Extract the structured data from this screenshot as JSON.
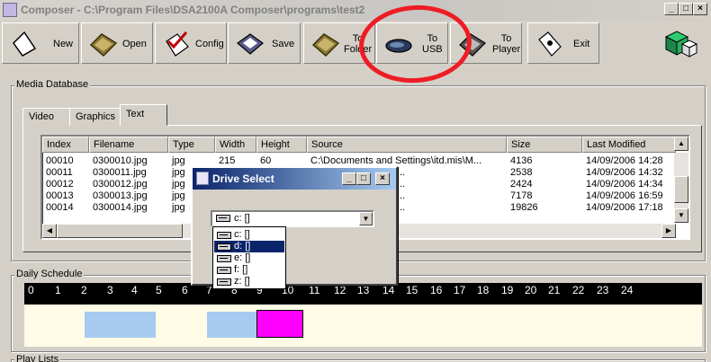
{
  "window": {
    "title": "Composer - C:\\Program Files\\DSA2100A Composer\\programs\\test2"
  },
  "toolbar": {
    "new": "New",
    "open": "Open",
    "config": "Config",
    "save": "Save",
    "to_folder": "To Folder",
    "to_usb": "To USB",
    "to_player": "To Player",
    "exit": "Exit"
  },
  "media_db": {
    "legend": "Media Database",
    "tabs": [
      "Video",
      "Graphics",
      "Text"
    ],
    "active_tab": "Text",
    "columns": [
      "Index",
      "Filename",
      "Type",
      "Width",
      "Height",
      "Source",
      "Size",
      "Last Modified"
    ],
    "rows": [
      [
        "00010",
        "0300010.jpg",
        "jpg",
        "215",
        "60",
        "C:\\Documents and Settings\\itd.mis\\M...",
        "4136",
        "14/09/2006 14:28"
      ],
      [
        "00011",
        "0300011.jpg",
        "jpg",
        "",
        "",
        "d Settings\\itd.mis\\M...",
        "2538",
        "14/09/2006 14:32"
      ],
      [
        "00012",
        "0300012.jpg",
        "jpg",
        "",
        "",
        "d Settings\\itd.mis\\M...",
        "2424",
        "14/09/2006 14:34"
      ],
      [
        "00013",
        "0300013.jpg",
        "jpg",
        "",
        "",
        "d Settings\\itd.mis\\M...",
        "7178",
        "14/09/2006 16:59"
      ],
      [
        "00014",
        "0300014.jpg",
        "jpg",
        "",
        "",
        "d Settings\\itd.mis\\M...",
        "19826",
        "14/09/2006 17:18"
      ]
    ]
  },
  "schedule": {
    "legend": "Daily Schedule",
    "hours": [
      "0",
      "1",
      "2",
      "3",
      "4",
      "5",
      "6",
      "7",
      "8",
      "9",
      "10",
      "11",
      "12",
      "13",
      "14",
      "15",
      "16",
      "17",
      "18",
      "19",
      "20",
      "21",
      "22",
      "23",
      "24"
    ],
    "colors": {
      "blue_block": "#a6caf0",
      "magenta_block": "#ff00ff",
      "timeline_bg": "#000000",
      "area_bg": "#fffbe6"
    }
  },
  "playlists": {
    "legend": "Play Lists"
  },
  "drive_dialog": {
    "title": "Drive Select",
    "selected": "c: []",
    "options": [
      "c: []",
      "d: []",
      "e: []",
      "f: []",
      "z: []"
    ],
    "highlighted": "d: []"
  },
  "annotation": {
    "circle_color": "#ee1c24",
    "circled_item": "To USB"
  }
}
